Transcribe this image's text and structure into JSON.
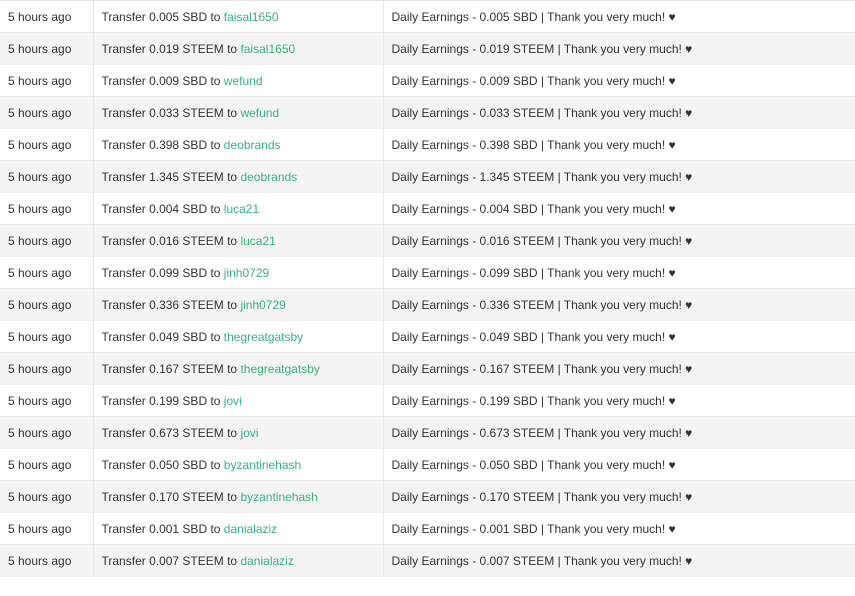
{
  "transfers": [
    {
      "time": "5 hours ago",
      "text": "Transfer 0.005 SBD to",
      "account": "faisal1650",
      "memo": "Daily Earnings - 0.005 SBD | Thank you very much! ♥"
    },
    {
      "time": "5 hours ago",
      "text": "Transfer 0.019 STEEM to",
      "account": "faisal1650",
      "memo": "Daily Earnings - 0.019 STEEM | Thank you very much! ♥"
    },
    {
      "time": "5 hours ago",
      "text": "Transfer 0.009 SBD to",
      "account": "wefund",
      "memo": "Daily Earnings - 0.009 SBD | Thank you very much! ♥"
    },
    {
      "time": "5 hours ago",
      "text": "Transfer 0.033 STEEM to",
      "account": "wefund",
      "memo": "Daily Earnings - 0.033 STEEM | Thank you very much! ♥"
    },
    {
      "time": "5 hours ago",
      "text": "Transfer 0.398 SBD to",
      "account": "deobrands",
      "memo": "Daily Earnings - 0.398 SBD | Thank you very much! ♥"
    },
    {
      "time": "5 hours ago",
      "text": "Transfer 1.345 STEEM to",
      "account": "deobrands",
      "memo": "Daily Earnings - 1.345 STEEM | Thank you very much! ♥"
    },
    {
      "time": "5 hours ago",
      "text": "Transfer 0.004 SBD to",
      "account": "luca21",
      "memo": "Daily Earnings - 0.004 SBD | Thank you very much! ♥"
    },
    {
      "time": "5 hours ago",
      "text": "Transfer 0.016 STEEM to",
      "account": "luca21",
      "memo": "Daily Earnings - 0.016 STEEM | Thank you very much! ♥"
    },
    {
      "time": "5 hours ago",
      "text": "Transfer 0.099 SBD to",
      "account": "jinh0729",
      "memo": "Daily Earnings - 0.099 SBD | Thank you very much! ♥"
    },
    {
      "time": "5 hours ago",
      "text": "Transfer 0.336 STEEM to",
      "account": "jinh0729",
      "memo": "Daily Earnings - 0.336 STEEM | Thank you very much! ♥"
    },
    {
      "time": "5 hours ago",
      "text": "Transfer 0.049 SBD to",
      "account": "thegreatgatsby",
      "memo": "Daily Earnings - 0.049 SBD | Thank you very much! ♥"
    },
    {
      "time": "5 hours ago",
      "text": "Transfer 0.167 STEEM to",
      "account": "thegreatgatsby",
      "memo": "Daily Earnings - 0.167 STEEM | Thank you very much! ♥"
    },
    {
      "time": "5 hours ago",
      "text": "Transfer 0.199 SBD to",
      "account": "jovi",
      "memo": "Daily Earnings - 0.199 SBD | Thank you very much! ♥"
    },
    {
      "time": "5 hours ago",
      "text": "Transfer 0.673 STEEM to",
      "account": "jovi",
      "memo": "Daily Earnings - 0.673 STEEM | Thank you very much! ♥"
    },
    {
      "time": "5 hours ago",
      "text": "Transfer 0.050 SBD to",
      "account": "byzantinehash",
      "memo": "Daily Earnings - 0.050 SBD | Thank you very much! ♥"
    },
    {
      "time": "5 hours ago",
      "text": "Transfer 0.170 STEEM to",
      "account": "byzantinehash",
      "memo": "Daily Earnings - 0.170 STEEM | Thank you very much! ♥"
    },
    {
      "time": "5 hours ago",
      "text": "Transfer 0.001 SBD to",
      "account": "danialaziz",
      "memo": "Daily Earnings - 0.001 SBD | Thank you very much! ♥"
    },
    {
      "time": "5 hours ago",
      "text": "Transfer 0.007 STEEM to",
      "account": "danialaziz",
      "memo": "Daily Earnings - 0.007 STEEM | Thank you very much! ♥"
    }
  ],
  "colors": {
    "account_link": "#3ab17f",
    "row_stripe": "#f4f4f4"
  }
}
